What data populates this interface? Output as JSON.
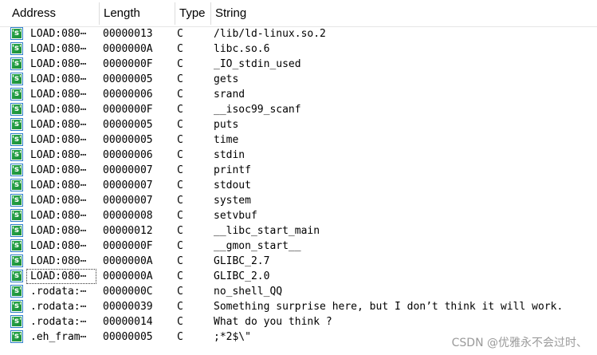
{
  "columns": {
    "address": "Address",
    "length": "Length",
    "type": "Type",
    "string": "String"
  },
  "icon": "string-type-icon",
  "icon_glyph": "'s'",
  "selected_row_index": 17,
  "rows": [
    {
      "address": "LOAD:080⋯",
      "length": "00000013",
      "type": "C",
      "string": "/lib/ld-linux.so.2"
    },
    {
      "address": "LOAD:080⋯",
      "length": "0000000A",
      "type": "C",
      "string": "libc.so.6"
    },
    {
      "address": "LOAD:080⋯",
      "length": "0000000F",
      "type": "C",
      "string": "_IO_stdin_used"
    },
    {
      "address": "LOAD:080⋯",
      "length": "00000005",
      "type": "C",
      "string": "gets"
    },
    {
      "address": "LOAD:080⋯",
      "length": "00000006",
      "type": "C",
      "string": "srand"
    },
    {
      "address": "LOAD:080⋯",
      "length": "0000000F",
      "type": "C",
      "string": "__isoc99_scanf"
    },
    {
      "address": "LOAD:080⋯",
      "length": "00000005",
      "type": "C",
      "string": "puts"
    },
    {
      "address": "LOAD:080⋯",
      "length": "00000005",
      "type": "C",
      "string": "time"
    },
    {
      "address": "LOAD:080⋯",
      "length": "00000006",
      "type": "C",
      "string": "stdin"
    },
    {
      "address": "LOAD:080⋯",
      "length": "00000007",
      "type": "C",
      "string": "printf"
    },
    {
      "address": "LOAD:080⋯",
      "length": "00000007",
      "type": "C",
      "string": "stdout"
    },
    {
      "address": "LOAD:080⋯",
      "length": "00000007",
      "type": "C",
      "string": "system"
    },
    {
      "address": "LOAD:080⋯",
      "length": "00000008",
      "type": "C",
      "string": "setvbuf"
    },
    {
      "address": "LOAD:080⋯",
      "length": "00000012",
      "type": "C",
      "string": "__libc_start_main"
    },
    {
      "address": "LOAD:080⋯",
      "length": "0000000F",
      "type": "C",
      "string": "__gmon_start__"
    },
    {
      "address": "LOAD:080⋯",
      "length": "0000000A",
      "type": "C",
      "string": "GLIBC_2.7"
    },
    {
      "address": "LOAD:080⋯",
      "length": "0000000A",
      "type": "C",
      "string": "GLIBC_2.0"
    },
    {
      "address": ".rodata:⋯",
      "length": "0000000C",
      "type": "C",
      "string": "no_shell_QQ"
    },
    {
      "address": ".rodata:⋯",
      "length": "00000039",
      "type": "C",
      "string": "Something surprise here, but I don’t think it will work."
    },
    {
      "address": ".rodata:⋯",
      "length": "00000014",
      "type": "C",
      "string": "What do you think ?"
    },
    {
      "address": ".eh_fram⋯",
      "length": "00000005",
      "type": "C",
      "string": ";*2$\\\""
    }
  ],
  "watermark": "CSDN @优雅永不会过时、"
}
